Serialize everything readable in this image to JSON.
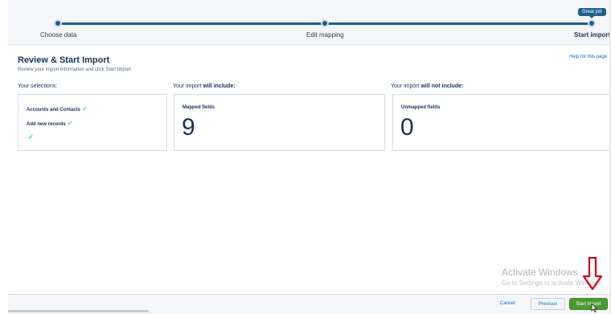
{
  "stepper": {
    "steps": [
      {
        "label": "Choose data"
      },
      {
        "label": "Edit mapping"
      },
      {
        "label": "Start import"
      }
    ],
    "tooltip": "Great job"
  },
  "help_link": "Help for this page",
  "page": {
    "title": "Review & Start Import",
    "subtitle": "Review your import information and click Start Import."
  },
  "selections": {
    "heading": "Your selections:",
    "items": [
      "Accounts and Contacts",
      "Add new records"
    ]
  },
  "includes": {
    "heading_prefix": "Your import ",
    "heading_bold": "will include:",
    "label": "Mapped fields",
    "value": "9"
  },
  "excludes": {
    "heading_prefix": "Your import ",
    "heading_bold": "will not include:",
    "label": "Unmapped fields",
    "value": "0"
  },
  "watermark": {
    "title": "Activate Windows",
    "subtitle": "Go to Settings to activate Windows."
  },
  "footer": {
    "cancel": "Cancel",
    "previous": "Previous",
    "start": "Start Import"
  },
  "colors": {
    "accent": "#1f5f8b",
    "link": "#0070d2",
    "success": "#4a9a2e",
    "check": "#4bca81",
    "annotation": "#d0021b"
  },
  "icons": [
    "check-icon",
    "down-arrow-icon",
    "cursor-icon"
  ]
}
